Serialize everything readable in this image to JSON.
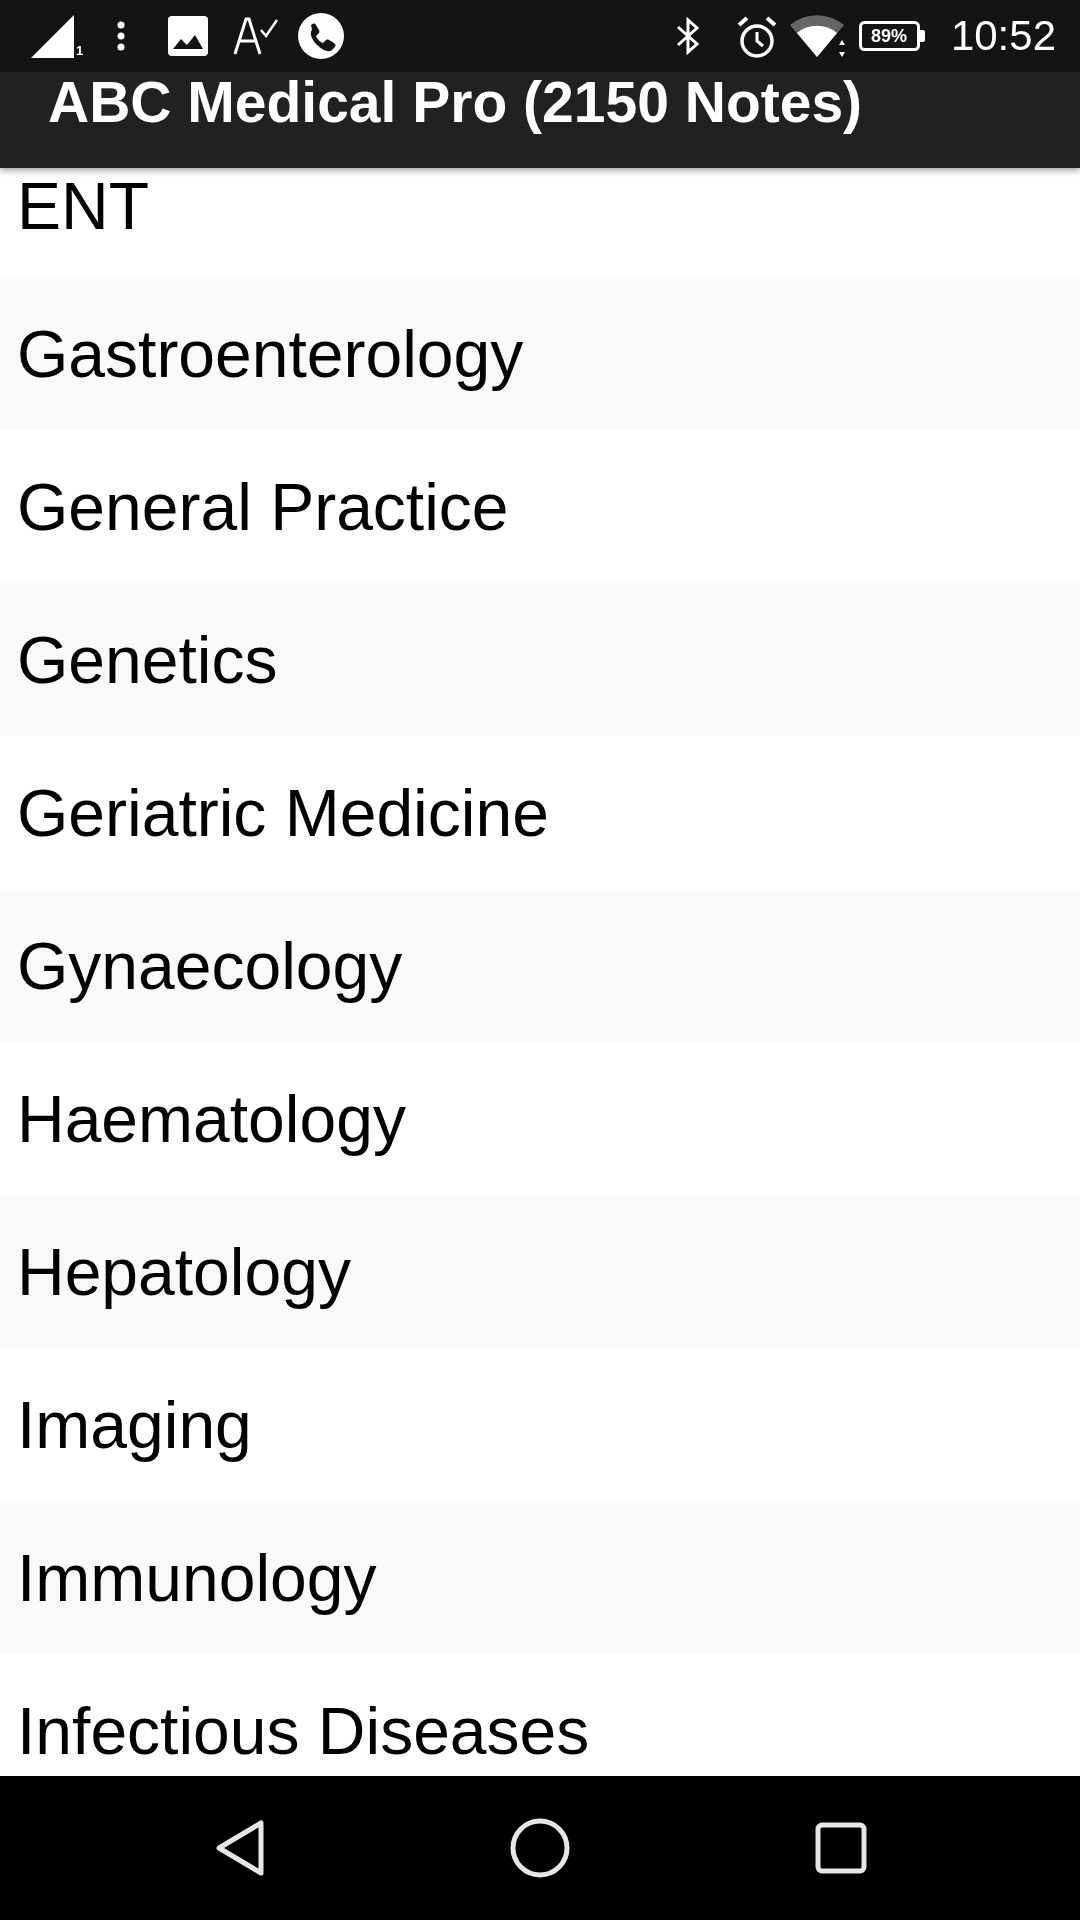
{
  "status_bar": {
    "sim_slot": "1",
    "battery": "89%",
    "time": "10:52"
  },
  "app_bar": {
    "title": "ABC Medical Pro (2150 Notes)"
  },
  "list": {
    "items": [
      {
        "label": "ENT"
      },
      {
        "label": "Gastroenterology"
      },
      {
        "label": "General Practice"
      },
      {
        "label": "Genetics"
      },
      {
        "label": "Geriatric Medicine"
      },
      {
        "label": "Gynaecology"
      },
      {
        "label": "Haematology"
      },
      {
        "label": "Hepatology"
      },
      {
        "label": "Imaging"
      },
      {
        "label": "Immunology"
      },
      {
        "label": "Infectious Diseases"
      }
    ]
  }
}
